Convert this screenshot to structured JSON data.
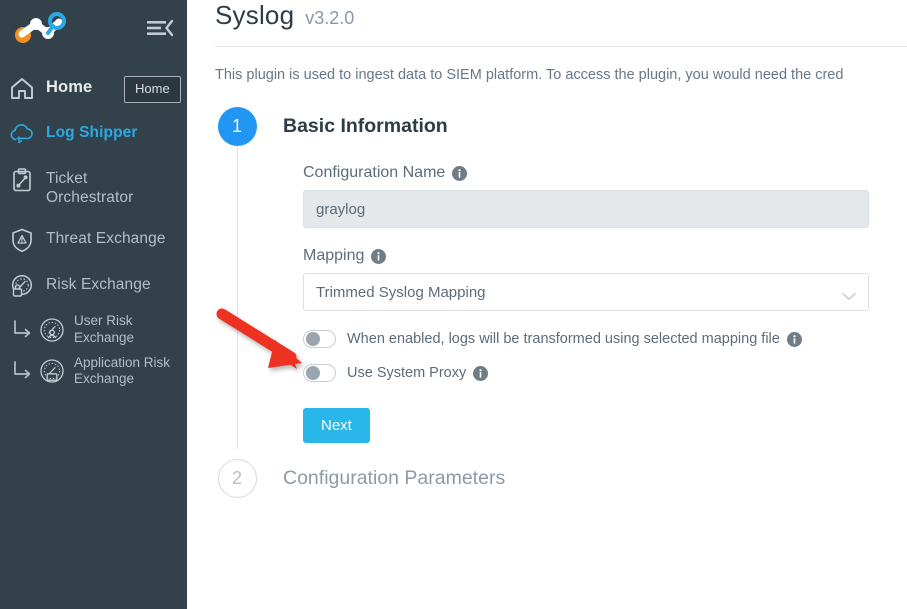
{
  "sidebar": {
    "logo_name": "netskope-logo",
    "collapse_icon": "hamburger-collapse-icon",
    "tooltip": {
      "label": "Home"
    },
    "items": [
      {
        "label": "Home",
        "icon": "home-icon",
        "state": "home"
      },
      {
        "label": "Log Shipper",
        "icon": "cloud-upload-icon",
        "state": "active"
      },
      {
        "label": "Ticket Orchestrator",
        "icon": "clipboard-icon",
        "state": "normal"
      },
      {
        "label": "Threat Exchange",
        "icon": "shield-warning-icon",
        "state": "normal"
      },
      {
        "label": "Risk Exchange",
        "icon": "risk-gauge-icon",
        "state": "normal"
      }
    ],
    "sub_items": [
      {
        "label": "User Risk Exchange",
        "icon": "user-risk-icon"
      },
      {
        "label": "Application Risk Exchange",
        "icon": "application-risk-icon"
      }
    ]
  },
  "header": {
    "title": "Syslog",
    "version": "v3.2.0",
    "description": "This plugin is used to ingest data to SIEM platform. To access the plugin, you would need the cred"
  },
  "stepper": {
    "step1": {
      "number": "1",
      "title": "Basic Information",
      "config_name": {
        "label": "Configuration Name",
        "value": "graylog",
        "info_icon": "info-icon"
      },
      "mapping": {
        "label": "Mapping",
        "value": "Trimmed Syslog Mapping",
        "info_icon": "info-icon",
        "chevron_icon": "chevron-down-icon"
      },
      "toggles": [
        {
          "label": "When enabled, logs will be transformed using selected mapping file",
          "checked": false,
          "info_icon": "info-icon"
        },
        {
          "label": "Use System Proxy",
          "checked": false,
          "info_icon": "info-icon"
        }
      ],
      "next_label": "Next"
    },
    "step2": {
      "number": "2",
      "title": "Configuration Parameters"
    }
  },
  "annotation": {
    "type": "red-arrow",
    "color": "#ee3124"
  },
  "colors": {
    "sidebar_bg": "#33414b",
    "accent_blue": "#2196f3",
    "active_nav": "#2aaae2",
    "button_cyan": "#29b6e8",
    "arrow_red": "#ee3124"
  }
}
